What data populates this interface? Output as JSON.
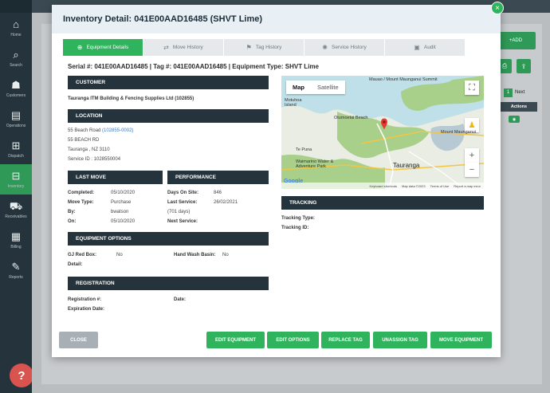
{
  "app": {
    "nav": [
      {
        "label": "Home",
        "icon": "home-icon",
        "glyph": "⌂"
      },
      {
        "label": "Search",
        "icon": "search-icon",
        "glyph": "⌕"
      },
      {
        "label": "Customers",
        "icon": "customers-icon",
        "glyph": "☗"
      },
      {
        "label": "Operations",
        "icon": "operations-icon",
        "glyph": "▤"
      },
      {
        "label": "Dispatch",
        "icon": "dispatch-icon",
        "glyph": "⊞"
      },
      {
        "label": "Inventory",
        "icon": "inventory-icon",
        "glyph": "⊟"
      },
      {
        "label": "Receivables",
        "icon": "receivables-icon",
        "glyph": "⛟"
      },
      {
        "label": "Billing",
        "icon": "billing-icon",
        "glyph": "▦"
      },
      {
        "label": "Reports",
        "icon": "reports-icon",
        "glyph": "✎"
      }
    ],
    "active_nav": "Inventory",
    "help_glyph": "?",
    "bg_add_label": "+ADD",
    "bg_page_number": "1",
    "bg_next_label": "Next",
    "bg_actions_header": "Actions"
  },
  "modal": {
    "title": "Inventory Detail: 041E00AAD16485 (SHVT Lime)",
    "close_glyph": "×",
    "tabs": [
      {
        "label": "Equipment Details",
        "icon": "info-icon",
        "glyph": "⊕",
        "active": true
      },
      {
        "label": "Move History",
        "icon": "move-icon",
        "glyph": "⇄",
        "active": false
      },
      {
        "label": "Tag History",
        "icon": "tag-icon",
        "glyph": "⚑",
        "active": false
      },
      {
        "label": "Service History",
        "icon": "service-icon",
        "glyph": "✺",
        "active": false
      },
      {
        "label": "Audit",
        "icon": "audit-icon",
        "glyph": "▣",
        "active": false
      }
    ],
    "serial_line": "Serial #: 041E00AAD16485 | Tag #: 041E00AAD16485 | Equipment Type: SHVT Lime",
    "customer": {
      "heading": "CUSTOMER",
      "name": "Tauranga ITM Building & Fencing Supplies Ltd (102855)"
    },
    "location": {
      "heading": "LOCATION",
      "line1_prefix": "55 Beach Road",
      "line1_link": "(102855-0002)",
      "line2": "55 BEACH RD",
      "line3": "Tauranga , NZ 3110",
      "line4": "Service ID : 1028550004"
    },
    "last_move": {
      "heading": "LAST MOVE",
      "rows": [
        {
          "label": "Completed:",
          "value": "05/10/2020"
        },
        {
          "label": "Move Type:",
          "value": "Purchase"
        },
        {
          "label": "By:",
          "value": "bwatson"
        },
        {
          "label": "On:",
          "value": "05/10/2020"
        }
      ]
    },
    "performance": {
      "heading": "PERFORMANCE",
      "rows": [
        {
          "label": "Days On Site:",
          "value": "846"
        },
        {
          "label": "Last Service:",
          "value": "26/02/2021"
        },
        {
          "label": "",
          "value": "(701 days)"
        },
        {
          "label": "Next Service:",
          "value": ""
        }
      ]
    },
    "equipment_options": {
      "heading": "EQUIPMENT OPTIONS",
      "gj_red_box_label": "GJ Red Box:",
      "gj_red_box_value": "No",
      "hand_wash_label": "Hand Wash Basin:",
      "hand_wash_value": "No",
      "detail_label": "Detail:"
    },
    "registration": {
      "heading": "REGISTRATION",
      "registration_label": "Registration #:",
      "date_label": "Date:",
      "expiration_label": "Expiration Date:"
    },
    "tracking": {
      "heading": "TRACKING",
      "type_label": "Tracking Type:",
      "id_label": "Tracking ID:"
    },
    "map": {
      "map_label": "Map",
      "satellite_label": "Satellite",
      "fullscreen_glyph": "⛶",
      "zoom_in": "+",
      "zoom_out": "−",
      "google_label": "Google",
      "places": [
        "Mauao / Mount Maunganui Summit",
        "Motuhoa Island",
        "Otumoetai Beach",
        "Mount Maunganui",
        "Te Puna",
        "Waimarino Water & Adventure Park",
        "Tauranga"
      ],
      "footer": [
        "Keyboard shortcuts",
        "Map data ©2023",
        "Terms of Use",
        "Report a map error"
      ]
    },
    "buttons": {
      "close": "CLOSE",
      "edit_equipment": "EDIT EQUIPMENT",
      "edit_options": "EDIT OPTIONS",
      "replace_tag": "REPLACE TAG",
      "unassign_tag": "UNASSIGN TAG",
      "move_equipment": "MOVE EQUIPMENT"
    }
  }
}
